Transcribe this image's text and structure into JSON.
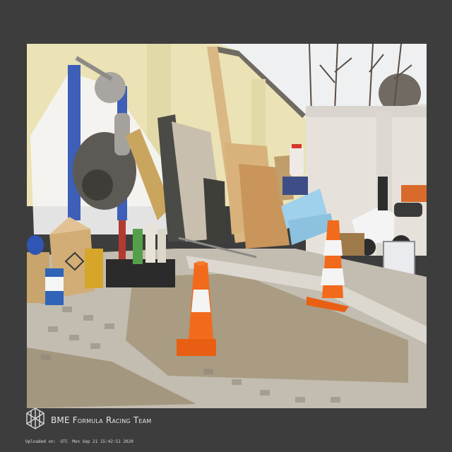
{
  "photo": {
    "scene": "yard-with-traffic-cones"
  },
  "footer": {
    "team_name": "BME Formula Racing Team",
    "upload_label": "Uploaded on:",
    "upload_tz": "UTC",
    "upload_date": "Mon Sep 21 15:42:51 2020"
  },
  "colors": {
    "background": "#3d3d3d",
    "cone_orange": "#f26a1b",
    "cone_white": "#f4f4f4",
    "wall": "#e9e1b6",
    "sky": "#f2f2f2"
  }
}
